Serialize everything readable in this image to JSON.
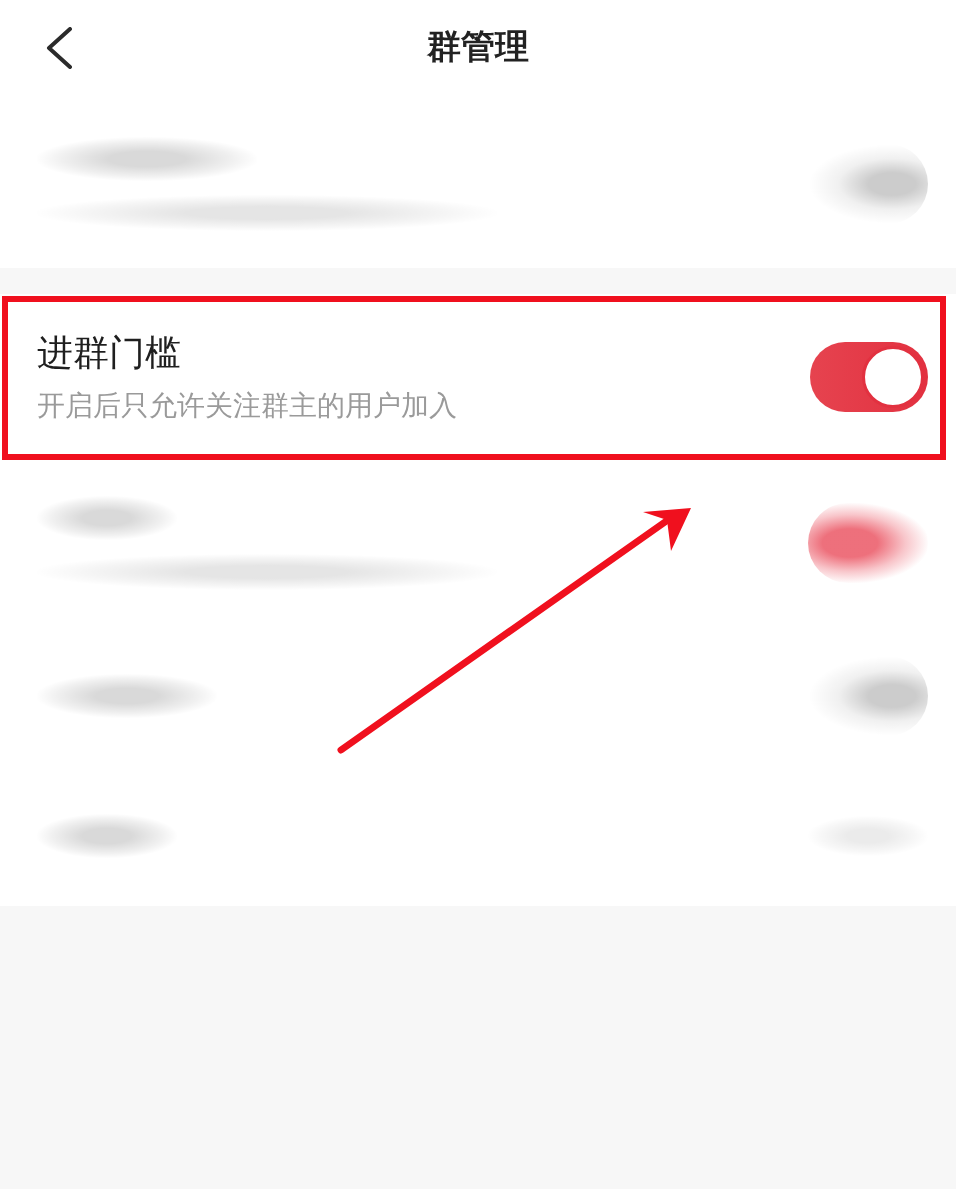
{
  "header": {
    "title": "群管理"
  },
  "rows": [
    {
      "kind": "blurtoggle",
      "two_lines": true,
      "on": false,
      "highlighted": false
    },
    {
      "kind": "toggle",
      "title": "进群门槛",
      "subtitle": "开启后只允许关注群主的用户加入",
      "on": true,
      "highlighted": true
    },
    {
      "kind": "blurtoggle",
      "two_lines": true,
      "on": true,
      "highlighted": false
    },
    {
      "kind": "blurtoggle",
      "two_lines": false,
      "on": false,
      "highlighted": false
    },
    {
      "kind": "blurvalue",
      "two_lines": false,
      "highlighted": false
    }
  ],
  "annotations": [
    {
      "kind": "arrow"
    }
  ]
}
